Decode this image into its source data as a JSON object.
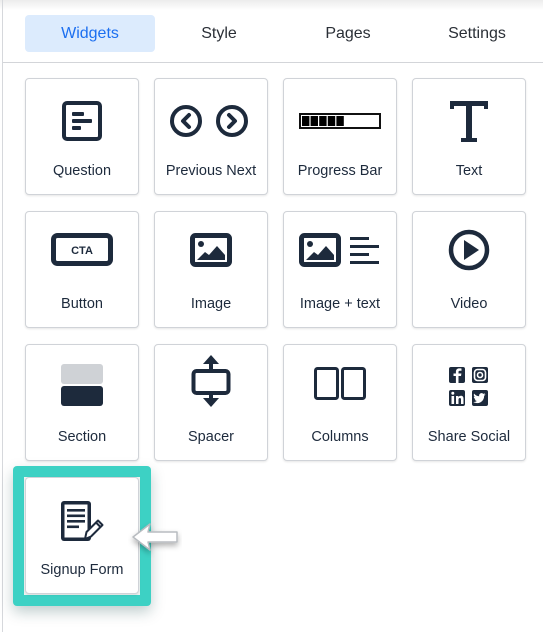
{
  "tabs": [
    {
      "label": "Widgets",
      "active": true
    },
    {
      "label": "Style",
      "active": false
    },
    {
      "label": "Pages",
      "active": false
    },
    {
      "label": "Settings",
      "active": false
    }
  ],
  "widgets": [
    {
      "label": "Question",
      "icon": "question-icon"
    },
    {
      "label": "Previous Next",
      "icon": "previous-next-icon"
    },
    {
      "label": "Progress Bar",
      "icon": "progress-bar-icon",
      "progress_filled_segments": 5
    },
    {
      "label": "Text",
      "icon": "text-icon"
    },
    {
      "label": "Button",
      "icon": "button-icon",
      "icon_text": "CTA"
    },
    {
      "label": "Image",
      "icon": "image-icon"
    },
    {
      "label": "Image + text",
      "icon": "image-text-icon"
    },
    {
      "label": "Video",
      "icon": "video-play-icon"
    },
    {
      "label": "Section",
      "icon": "section-icon"
    },
    {
      "label": "Spacer",
      "icon": "spacer-icon"
    },
    {
      "label": "Columns",
      "icon": "columns-icon"
    },
    {
      "label": "Share Social",
      "icon": "share-social-icon"
    },
    {
      "label": "Signup Form",
      "icon": "signup-form-icon",
      "highlighted": true
    }
  ],
  "colors": {
    "accent": "#1c6ff0",
    "active_tab_bg": "#dcebfd",
    "icon": "#1d2a3c",
    "highlight": "#3dd1c4"
  }
}
